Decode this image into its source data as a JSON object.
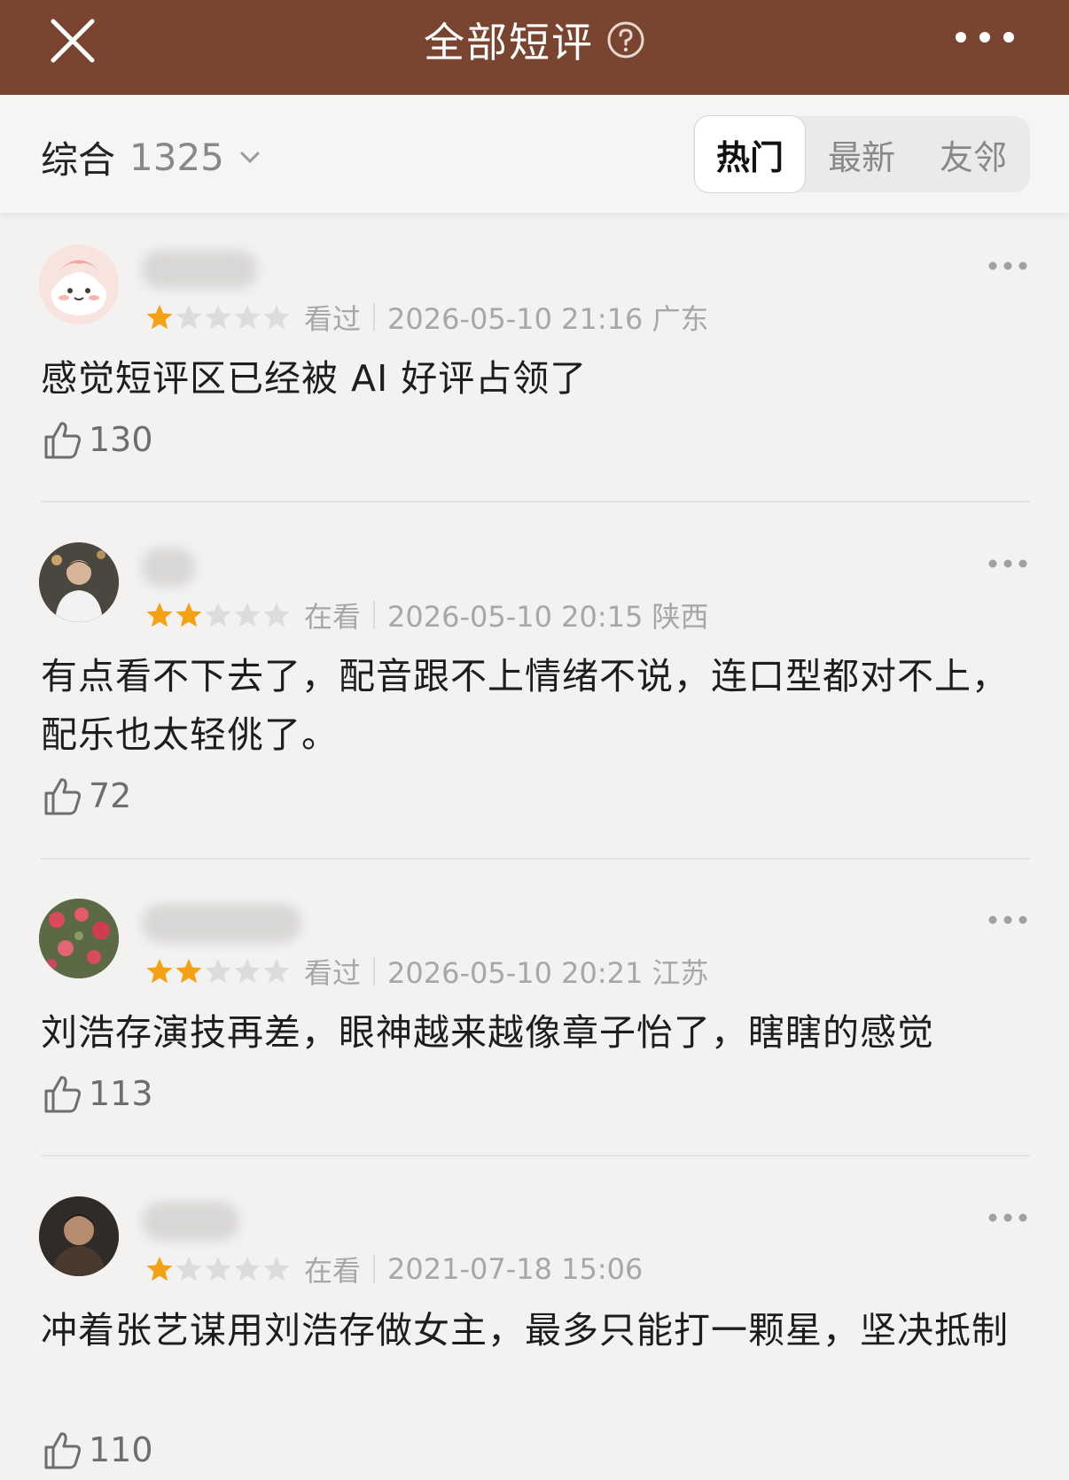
{
  "header": {
    "title": "全部短评",
    "colors": {
      "bar": "#7a4530",
      "text": "#ffffff"
    }
  },
  "sortbar": {
    "label": "综合",
    "count": "1325",
    "tabs": [
      {
        "label": "热门",
        "active": true
      },
      {
        "label": "最新",
        "active": false
      },
      {
        "label": "友邻",
        "active": false
      }
    ]
  },
  "reviews": [
    {
      "stars": 1,
      "status": "看过",
      "datetime": "2026-05-10 21:16 广东",
      "text": "感觉短评区已经被 AI 好评占领了",
      "likes": "130"
    },
    {
      "stars": 2,
      "status": "在看",
      "datetime": "2026-05-10 20:15 陕西",
      "text": "有点看不下去了，配音跟不上情绪不说，连口型都对不上，配乐也太轻佻了。",
      "likes": "72"
    },
    {
      "stars": 2,
      "status": "看过",
      "datetime": "2026-05-10 20:21 江苏",
      "text": "刘浩存演技再差，眼神越来越像章子怡了，瞎瞎的感觉",
      "likes": "113"
    },
    {
      "stars": 1,
      "status": "在看",
      "datetime": "2021-07-18 15:06",
      "text": "冲着张艺谋用刘浩存做女主，最多只能打一颗星，坚决抵制",
      "likes": "110"
    }
  ],
  "colors": {
    "star_on": "#f4a213",
    "star_off": "#dcdcdc"
  }
}
